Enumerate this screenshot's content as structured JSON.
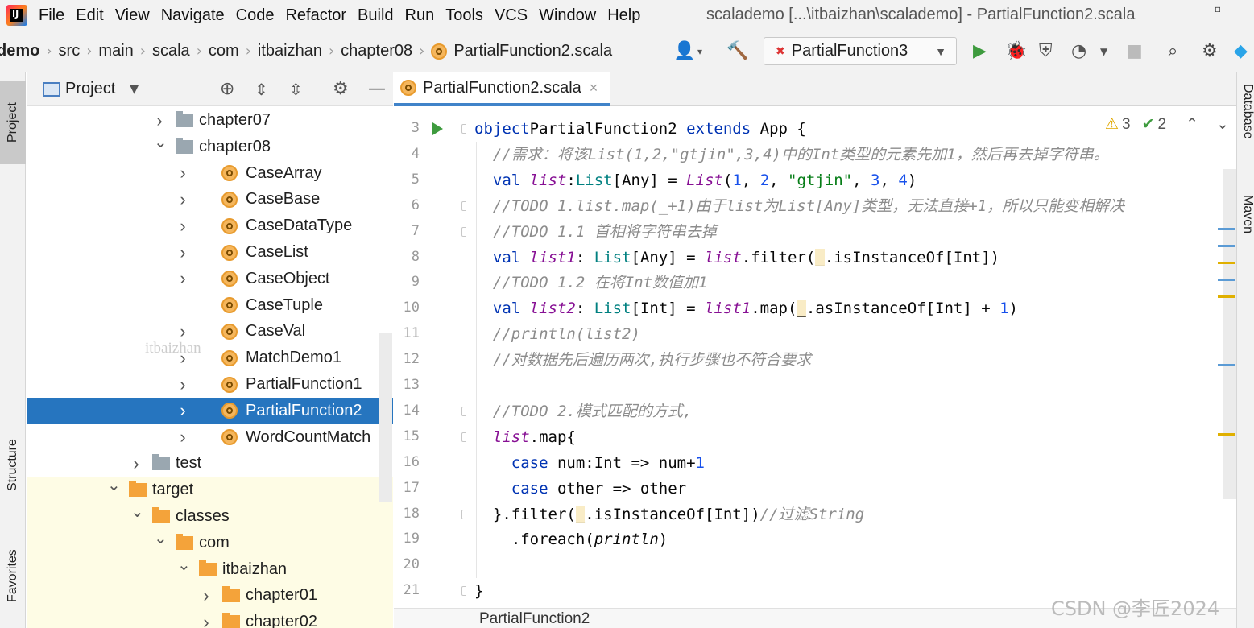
{
  "menubar": {
    "items": [
      "File",
      "Edit",
      "View",
      "Navigate",
      "Code",
      "Refactor",
      "Build",
      "Run",
      "Tools",
      "VCS",
      "Window",
      "Help"
    ],
    "window_title": "scalademo [...\\itbaizhan\\scalademo] - PartialFunction2.scala"
  },
  "navbar": {
    "crumbs": [
      "demo",
      "src",
      "main",
      "scala",
      "com",
      "itbaizhan",
      "chapter08",
      "PartialFunction2.scala"
    ],
    "run_config": "PartialFunction3"
  },
  "left_strip": {
    "project": "Project",
    "structure": "Structure",
    "favorites": "Favorites"
  },
  "right_strip": {
    "database": "Database",
    "maven": "Maven"
  },
  "project_panel": {
    "title": "Project",
    "tree": [
      {
        "label": "chapter07",
        "type": "folder-gray",
        "expand": "collapsed",
        "depth": 0
      },
      {
        "label": "chapter08",
        "type": "folder-gray",
        "expand": "expanded",
        "depth": 0
      },
      {
        "label": "CaseArray",
        "type": "scala",
        "expand": "collapsed",
        "depth": 1
      },
      {
        "label": "CaseBase",
        "type": "scala",
        "expand": "collapsed",
        "depth": 1
      },
      {
        "label": "CaseDataType",
        "type": "scala",
        "expand": "collapsed",
        "depth": 1
      },
      {
        "label": "CaseList",
        "type": "scala",
        "expand": "collapsed",
        "depth": 1
      },
      {
        "label": "CaseObject",
        "type": "scala",
        "expand": "collapsed",
        "depth": 1
      },
      {
        "label": "CaseTuple",
        "type": "scala",
        "expand": "none",
        "depth": 1
      },
      {
        "label": "CaseVal",
        "type": "scala",
        "expand": "collapsed",
        "depth": 1
      },
      {
        "label": "MatchDemo1",
        "type": "scala",
        "expand": "collapsed",
        "depth": 1
      },
      {
        "label": "PartialFunction1",
        "type": "scala",
        "expand": "collapsed",
        "depth": 1
      },
      {
        "label": "PartialFunction2",
        "type": "scala",
        "expand": "collapsed",
        "depth": 1,
        "selected": true
      },
      {
        "label": "WordCountMatch",
        "type": "scala",
        "expand": "collapsed",
        "depth": 1
      },
      {
        "label": "test",
        "type": "folder-gray",
        "expand": "collapsed",
        "depth": -1
      },
      {
        "label": "target",
        "type": "folder-orange",
        "expand": "expanded",
        "depth": -2,
        "yellow": true
      },
      {
        "label": "classes",
        "type": "folder-orange",
        "expand": "expanded",
        "depth": -1,
        "yellow": true
      },
      {
        "label": "com",
        "type": "folder-orange",
        "expand": "expanded",
        "depth": 0,
        "yellow": true
      },
      {
        "label": "itbaizhan",
        "type": "folder-orange",
        "expand": "expanded",
        "depth": 1,
        "yellow": true
      },
      {
        "label": "chapter01",
        "type": "folder-orange",
        "expand": "collapsed",
        "depth": 2,
        "yellow": true
      },
      {
        "label": "chapter02",
        "type": "folder-orange",
        "expand": "collapsed",
        "depth": 2,
        "yellow": true
      }
    ]
  },
  "editor": {
    "tab_label": "PartialFunction2.scala",
    "inspections": {
      "warnings": "3",
      "checks": "2"
    },
    "line_numbers": [
      "3",
      "4",
      "5",
      "6",
      "7",
      "8",
      "9",
      "10",
      "11",
      "12",
      "13",
      "14",
      "15",
      "16",
      "17",
      "18",
      "19",
      "20",
      "21"
    ],
    "code": [
      [
        [
          "kw",
          "object"
        ],
        [
          "",
          "PartialFunction2 "
        ],
        [
          "kw",
          "extends"
        ],
        [
          "",
          " App {"
        ]
      ],
      [
        [
          "cm",
          "  //需求：将该List(1,2,\"gtjin\",3,4)中的Int类型的元素先加1，然后再去掉字符串。"
        ]
      ],
      [
        [
          "kw",
          "  val "
        ],
        [
          "it",
          "list"
        ],
        [
          "",
          ":"
        ],
        [
          "ty",
          "List"
        ],
        [
          "",
          "[Any] = "
        ],
        [
          "it",
          "List"
        ],
        [
          "",
          "("
        ],
        [
          "num",
          "1"
        ],
        [
          "",
          ", "
        ],
        [
          "num",
          "2"
        ],
        [
          "",
          ", "
        ],
        [
          "str",
          "\"gtjin\""
        ],
        [
          "",
          ", "
        ],
        [
          "num",
          "3"
        ],
        [
          "",
          ", "
        ],
        [
          "num",
          "4"
        ],
        [
          "",
          ")"
        ]
      ],
      [
        [
          "cm",
          "  //TODO 1.list.map(_+1)由于list为List[Any]类型，无法直接+1，所以只能变相解决"
        ]
      ],
      [
        [
          "cm",
          "  //TODO 1.1 首相将字符串去掉"
        ]
      ],
      [
        [
          "kw",
          "  val "
        ],
        [
          "it",
          "list1"
        ],
        [
          "",
          ": "
        ],
        [
          "ty",
          "List"
        ],
        [
          "",
          "[Any] = "
        ],
        [
          "it",
          "list"
        ],
        [
          "",
          ".filter("
        ],
        [
          "uh",
          "_"
        ],
        [
          "",
          ".isInstanceOf[Int])"
        ]
      ],
      [
        [
          "cm",
          "  //TODO 1.2 在将Int数值加1"
        ]
      ],
      [
        [
          "kw",
          "  val "
        ],
        [
          "it",
          "list2"
        ],
        [
          "",
          ": "
        ],
        [
          "ty",
          "List"
        ],
        [
          "",
          "[Int] = "
        ],
        [
          "it",
          "list1"
        ],
        [
          "",
          ".map("
        ],
        [
          "uh",
          "_"
        ],
        [
          "",
          ".asInstanceOf[Int] + "
        ],
        [
          "num",
          "1"
        ],
        [
          "",
          ")"
        ]
      ],
      [
        [
          "cm",
          "  //println(list2)"
        ]
      ],
      [
        [
          "cm",
          "  //对数据先后遍历两次,执行步骤也不符合要求"
        ]
      ],
      [
        [
          "",
          ""
        ]
      ],
      [
        [
          "cm",
          "  //TODO 2.模式匹配的方式,"
        ]
      ],
      [
        [
          "it",
          "  list"
        ],
        [
          "",
          ".map{"
        ]
      ],
      [
        [
          "kw",
          "    case "
        ],
        [
          "",
          "num:Int => num+"
        ],
        [
          "num",
          "1"
        ]
      ],
      [
        [
          "kw",
          "    case "
        ],
        [
          "",
          "other => other"
        ]
      ],
      [
        [
          "",
          "  }.filter("
        ],
        [
          "uh",
          "_"
        ],
        [
          "",
          ".isInstanceOf[Int])"
        ],
        [
          "cm",
          "//过滤String"
        ]
      ],
      [
        [
          "",
          "    .foreach("
        ],
        [
          "fn",
          "println"
        ],
        [
          "",
          ")"
        ]
      ],
      [
        [
          "",
          ""
        ]
      ],
      [
        [
          "",
          "}"
        ]
      ]
    ],
    "bottom_breadcrumb": "PartialFunction2"
  },
  "watermark": "itbaizhan",
  "csdn_watermark": "CSDN @李匠2024",
  "colors": {
    "selection": "#2675bf",
    "keyword": "#0033b3",
    "comment": "#8c8c8c",
    "string": "#067d17",
    "number": "#1750eb",
    "field": "#871094",
    "run_green": "#3e9b3e",
    "folder_orange": "#f4a33a"
  }
}
